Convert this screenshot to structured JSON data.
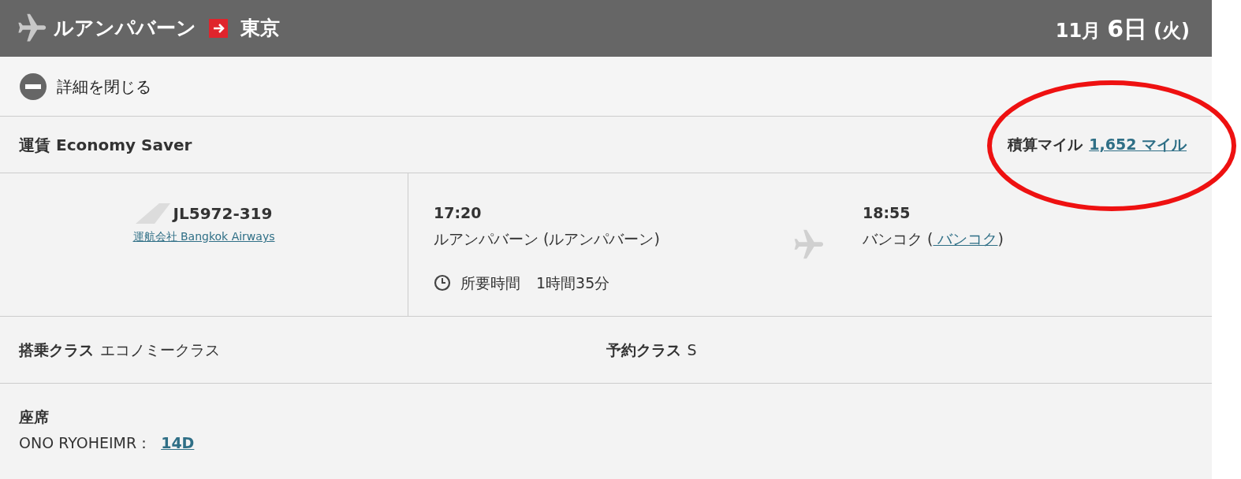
{
  "header": {
    "origin": "ルアンパバーン",
    "destination": "東京",
    "date_month": "11月",
    "date_day": "6日",
    "date_weekday": "(火)"
  },
  "toggle": {
    "label": "詳細を閉じる",
    "expanded": true
  },
  "fare": {
    "label": "運賃 Economy Saver",
    "miles_label": "積算マイル",
    "miles_link": "1,652 マイル",
    "highlighted": true
  },
  "flight": {
    "number": "JL5972-319",
    "operator": "運航会社 Bangkok Airways",
    "departure_time": "17:20",
    "departure_place": "ルアンパバーン (ルアンパバーン)",
    "duration_label": "所要時間",
    "duration": "1時間35分",
    "arrival_time": "18:55",
    "arrival_place": "バンコク (",
    "arrival_link": " バンコク",
    "arrival_close": ")"
  },
  "classes": [
    {
      "label": "搭乗クラス",
      "value": "エコノミークラス"
    },
    {
      "label": "予約クラス",
      "value": "S"
    }
  ],
  "seat": {
    "label": "座席",
    "passenger": "ONO RYOHEIMR：",
    "seat_link": "14D"
  }
}
